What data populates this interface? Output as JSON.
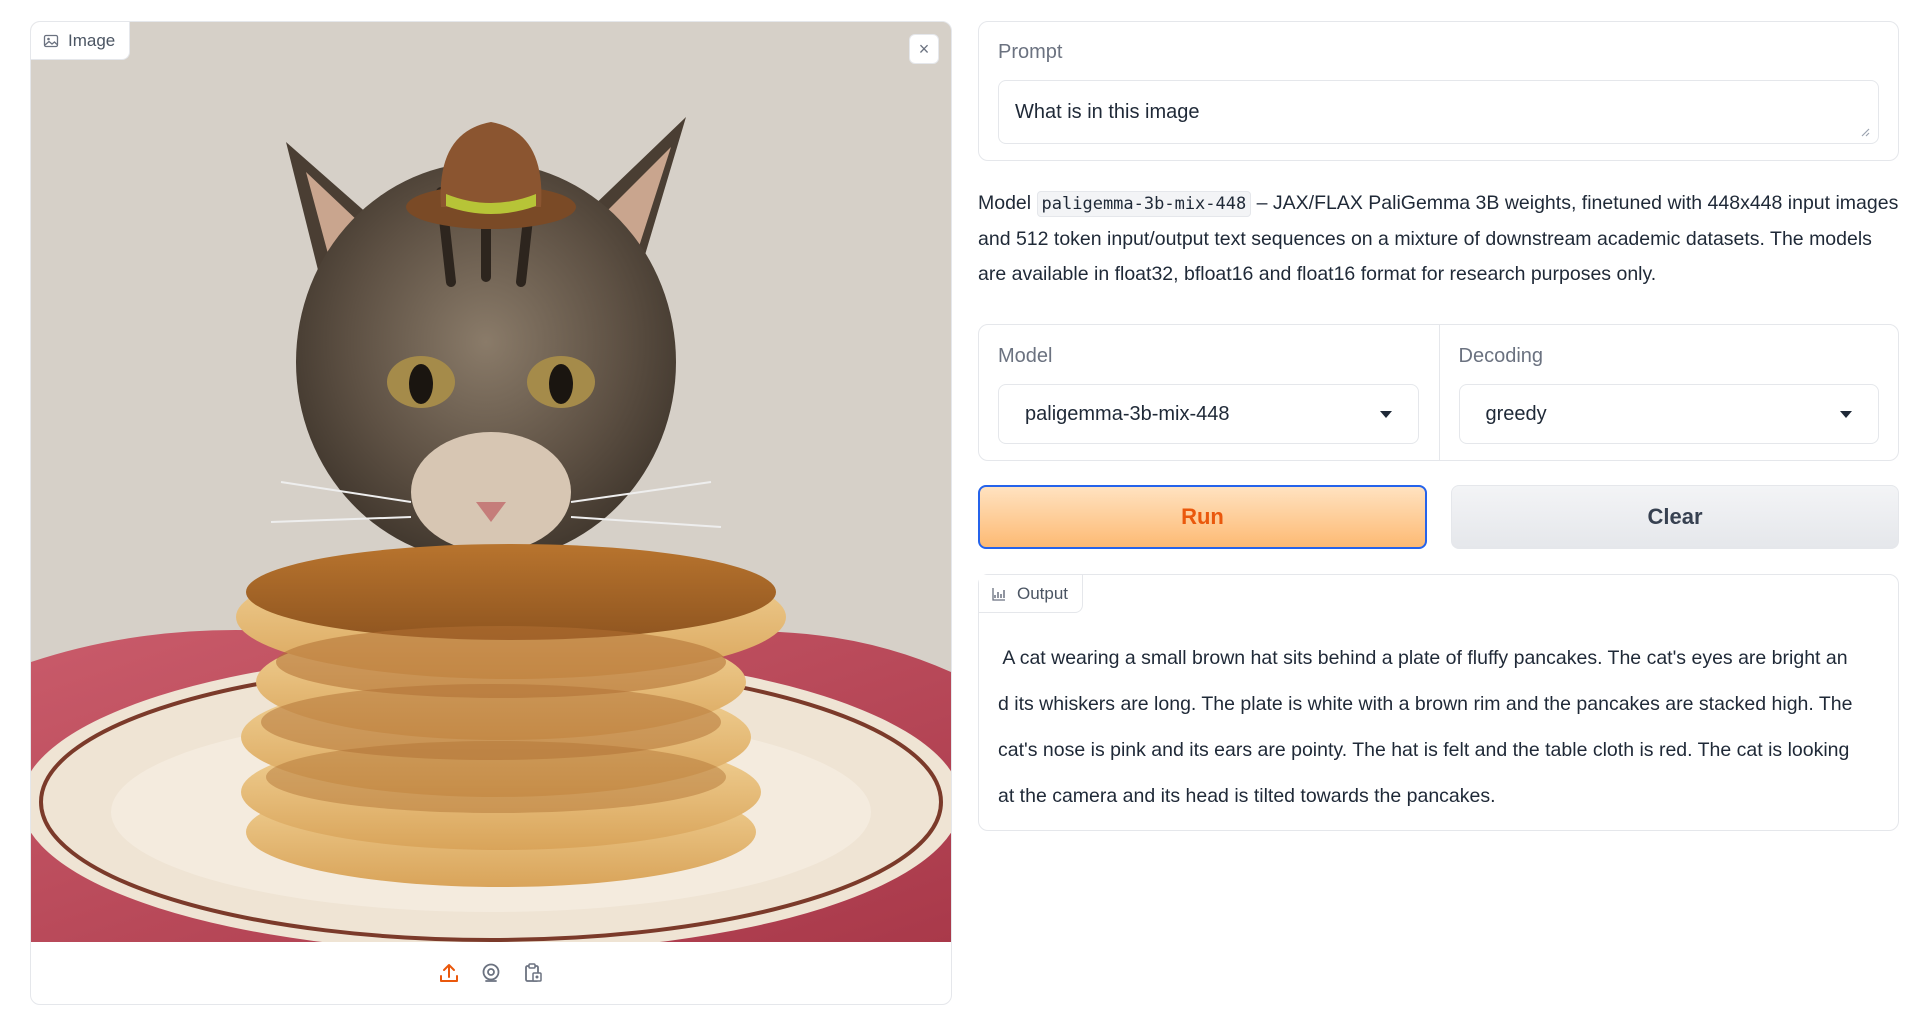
{
  "image_input": {
    "label": "Image",
    "close_glyph": "×",
    "icons": [
      "image-icon",
      "close-icon",
      "upload-icon",
      "webcam-icon",
      "clipboard-icon"
    ]
  },
  "prompt": {
    "label": "Prompt",
    "value": "What is in this image"
  },
  "description": {
    "prefix": "Model ",
    "model_code": "paligemma-3b-mix-448",
    "text": " – JAX/FLAX PaliGemma 3B weights, finetuned with 448x448 input images and 512 token input/output text sequences on a mixture of downstream academic datasets. The models are available in float32, bfloat16 and float16 format for research purposes only."
  },
  "model_select": {
    "label": "Model",
    "value": "paligemma-3b-mix-448"
  },
  "decoding_select": {
    "label": "Decoding",
    "value": "greedy"
  },
  "buttons": {
    "run": "Run",
    "clear": "Clear"
  },
  "output": {
    "label": "Output",
    "lines": [
      " A cat wearing a small brown hat sits behind a plate of fluffy pancakes. The cat's eyes are bright an",
      "d its whiskers are long. The plate is white with a brown rim and the pancakes are stacked high. The",
      "cat's nose is pink and its ears are pointy. The hat is felt and the table cloth is red. The cat is looking",
      "at the camera and its head is tilted towards the pancakes."
    ]
  },
  "colors": {
    "accent_orange": "#ea580c",
    "run_border": "#2563eb",
    "panel_border": "#e5e7eb"
  }
}
